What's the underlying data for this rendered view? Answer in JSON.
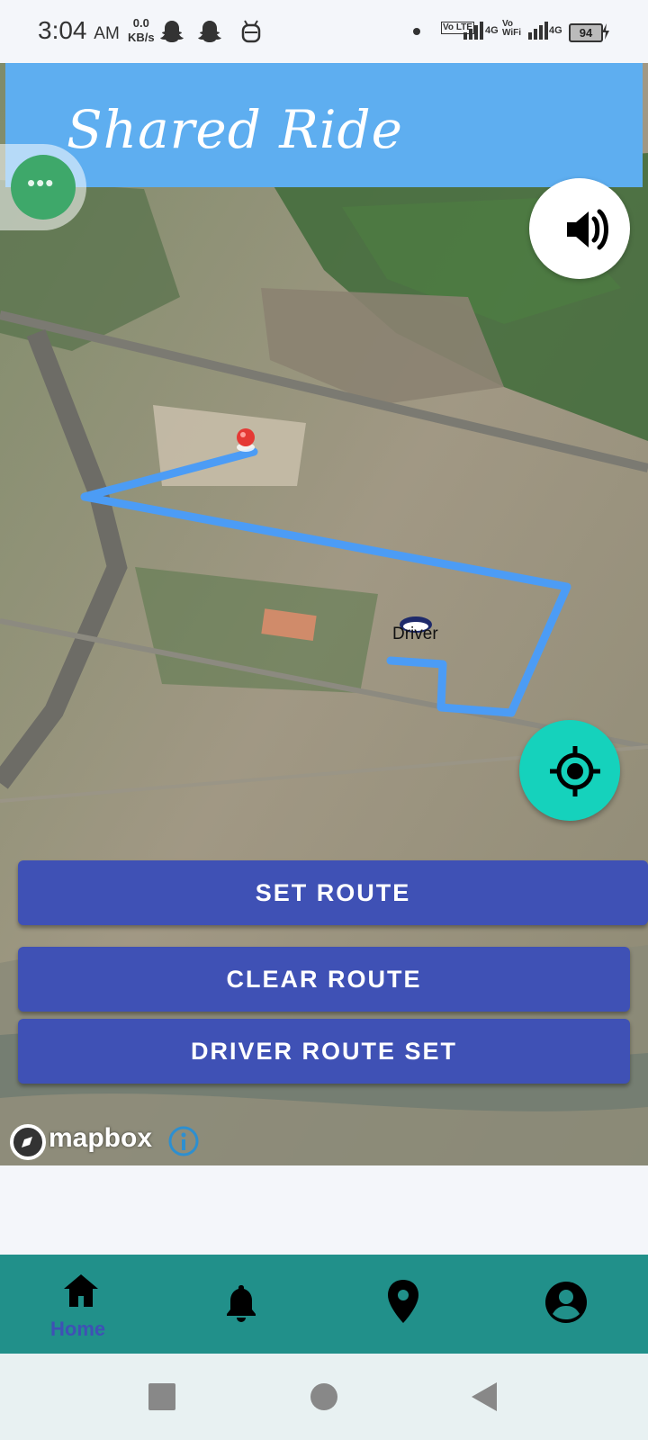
{
  "status_bar": {
    "time": "3:04",
    "ampm": "AM",
    "speed_value": "0.0",
    "speed_unit": "KB/s",
    "network_1": "4G",
    "network_2": "4G",
    "volte_label": "Vo LTE",
    "vowifi_label": "Vo WiFi",
    "battery": "94",
    "icons": [
      "snapchat-icon",
      "snapchat-icon",
      "android-debug-icon",
      "dot-icon",
      "signal-icon",
      "signal-icon",
      "charging-icon"
    ]
  },
  "app": {
    "title": "Shared Ride",
    "header_color": "#5eaef0"
  },
  "map": {
    "marker_label": "Driver",
    "attribution": "mapbox",
    "route_color": "#4c9cf5",
    "pin_color": "#e53935"
  },
  "buttons": {
    "set_route": "SET ROUTE",
    "clear_route": "CLEAR ROUTE",
    "driver_route_set": "DRIVER ROUTE SET",
    "button_color": "#3f51b5",
    "locate_color": "#15d2bc"
  },
  "bottom_nav": {
    "items": [
      {
        "icon": "home-icon",
        "label": "Home",
        "active": true
      },
      {
        "icon": "bell-icon",
        "label": ""
      },
      {
        "icon": "location-pin-icon",
        "label": ""
      },
      {
        "icon": "account-icon",
        "label": ""
      }
    ],
    "background": "#21908a"
  },
  "system_nav": [
    "recents-icon",
    "home-circle-icon",
    "back-icon"
  ]
}
